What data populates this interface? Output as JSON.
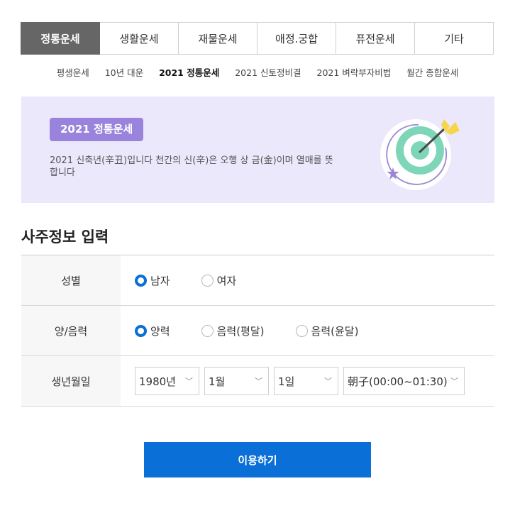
{
  "tabs": [
    {
      "label": "정통운세",
      "active": true
    },
    {
      "label": "생활운세"
    },
    {
      "label": "재물운세"
    },
    {
      "label": "애정.궁합"
    },
    {
      "label": "퓨전운세"
    },
    {
      "label": "기타"
    }
  ],
  "subnav": [
    {
      "label": "평생운세"
    },
    {
      "label": "10년 대운"
    },
    {
      "label": "2021 정통운세",
      "active": true
    },
    {
      "label": "2021 신토정비결"
    },
    {
      "label": "2021 벼락부자비법"
    },
    {
      "label": "월간 종합운세"
    }
  ],
  "banner": {
    "badge": "2021 정통운세",
    "description": "2021 신축년(辛丑)입니다 천간의 신(辛)은 오행 상 금(金)이며 열매를 뜻합니다",
    "icon": "target-arrow-icon"
  },
  "form": {
    "title": "사주정보 입력",
    "gender": {
      "label": "성별",
      "options": [
        "남자",
        "여자"
      ],
      "selected": 0
    },
    "calendar": {
      "label": "양/음력",
      "options": [
        "양력",
        "음력(평달)",
        "음력(윤달)"
      ],
      "selected": 0
    },
    "birth": {
      "label": "생년월일",
      "year": "1980년",
      "month": "1월",
      "day": "1일",
      "time": "朝子(00:00~01:30)"
    }
  },
  "submit_label": "이용하기",
  "colors": {
    "accent": "#0a6fd6",
    "tab_active": "#666666",
    "badge": "#9a83dc",
    "banner_bg": "#ebe8fc"
  }
}
